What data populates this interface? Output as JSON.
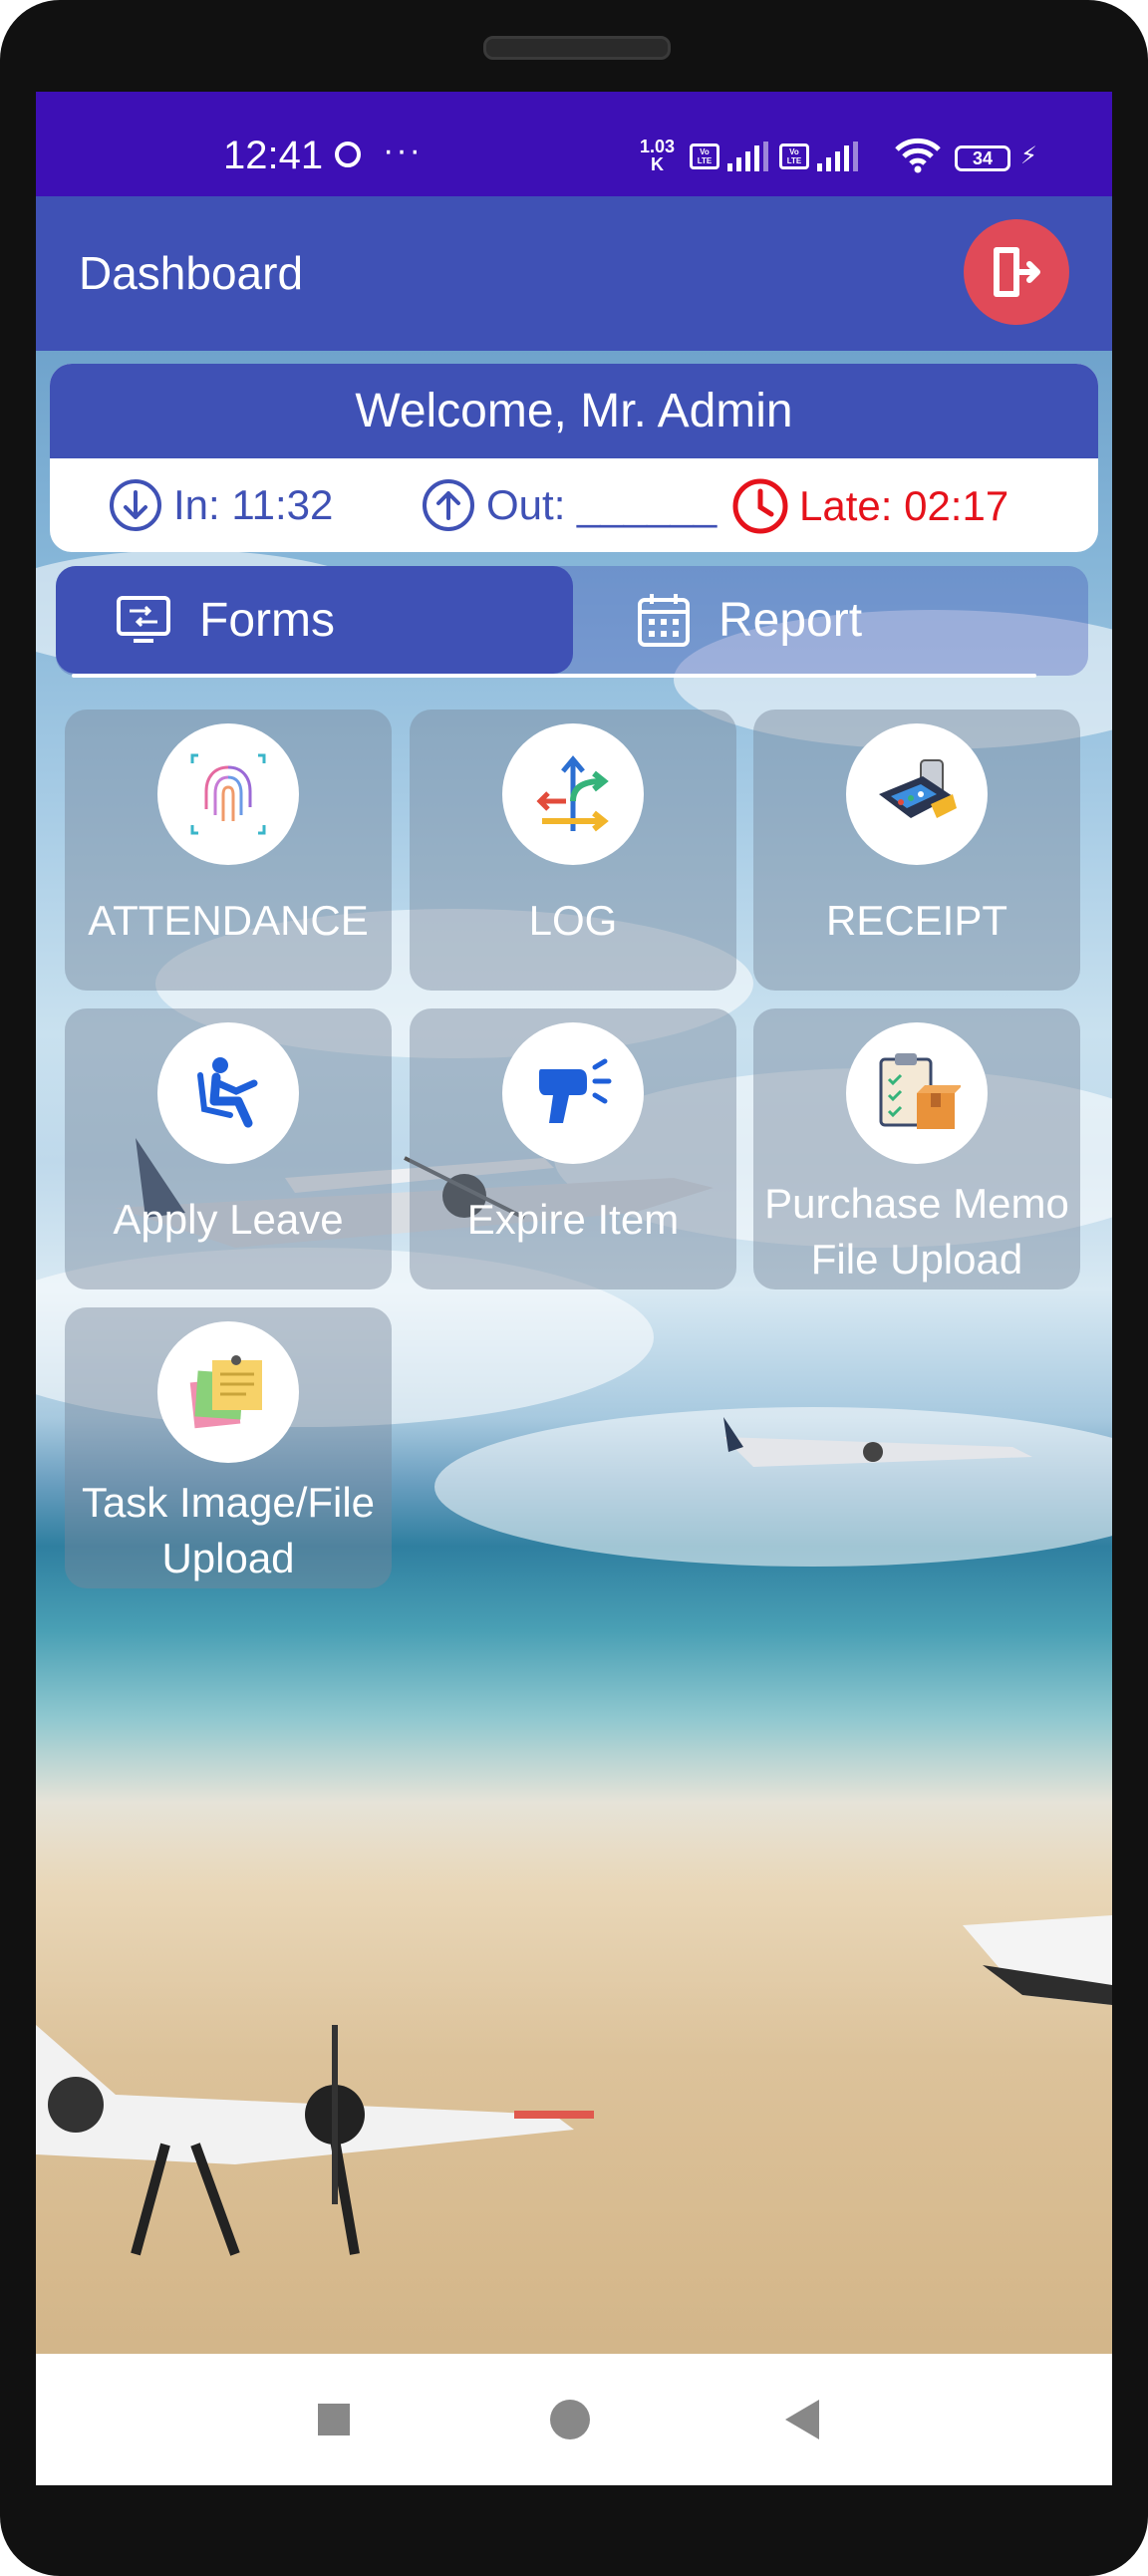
{
  "status_bar": {
    "time": "12:41",
    "dots": "···",
    "speed_value": "1.03",
    "speed_unit": "K",
    "volte_label": "Vo LTE",
    "battery": "34"
  },
  "app_bar": {
    "title": "Dashboard",
    "logout_icon": "logout-icon"
  },
  "welcome": {
    "greeting": "Welcome, Mr. Admin",
    "in_label": "In: 11:32",
    "out_label": "Out: ______",
    "late_label": "Late: 02:17"
  },
  "tabs": [
    {
      "label": "Forms",
      "icon": "forms-icon",
      "active": true
    },
    {
      "label": "Report",
      "icon": "calendar-icon",
      "active": false
    }
  ],
  "tiles": [
    {
      "label": "ATTENDANCE",
      "icon": "fingerprint-icon"
    },
    {
      "label": "LOG",
      "icon": "arrows-icon"
    },
    {
      "label": "RECEIPT",
      "icon": "payment-terminal-icon"
    },
    {
      "label": "Apply Leave",
      "icon": "seated-person-icon"
    },
    {
      "label": "Expire Item",
      "icon": "scanner-icon"
    },
    {
      "label_line1": "Purchase Memo",
      "label_line2": "File Upload",
      "icon": "clipboard-box-icon"
    },
    {
      "label_line1": "Task Image/File",
      "label_line2": "Upload",
      "icon": "sticky-notes-icon"
    }
  ],
  "colors": {
    "status_bar": "#3d0fb5",
    "primary": "#3f51b5",
    "logout": "#e04a58",
    "late": "#e5121b"
  }
}
